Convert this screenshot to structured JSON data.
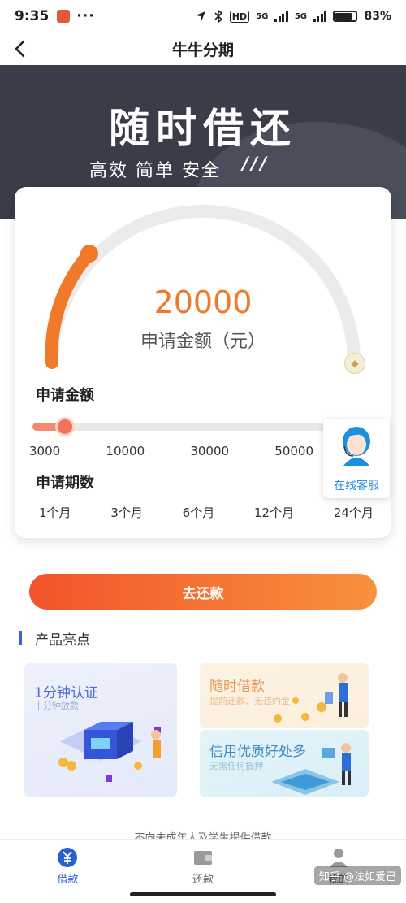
{
  "status_bar": {
    "time": "9:35",
    "dots": "···",
    "hd": "HD",
    "net1": "5G",
    "net2": "5G",
    "battery": "83%"
  },
  "nav": {
    "title": "牛牛分期"
  },
  "banner": {
    "title": "随时借还",
    "subtitle": "高效 简单 安全",
    "slashes": "///"
  },
  "loan": {
    "amount": "20000",
    "amount_label": "申请金额（元）",
    "amount_section_label": "申请金额",
    "slider_progress": 0.1,
    "amount_ticks": [
      "3000",
      "10000",
      "30000",
      "50000"
    ],
    "term_section_label": "申请期数",
    "terms": [
      "1个月",
      "3个月",
      "6个月",
      "12个月",
      "24个月"
    ]
  },
  "customer_service": {
    "label": "在线客服"
  },
  "repay_button": "去还款",
  "highlights": {
    "title": "产品亮点",
    "items": [
      {
        "title": "1分钟认证",
        "subtitle": "十分钟放款"
      },
      {
        "title": "随时借款",
        "subtitle": "提前还款、无违约金"
      },
      {
        "title": "信用优质好处多",
        "subtitle": "无需任何抵押"
      }
    ]
  },
  "footer_note": "不向未成年人及学生提供借款",
  "tabs": [
    {
      "label": "借款",
      "active": true
    },
    {
      "label": "还款",
      "active": false
    },
    {
      "label": "我的",
      "active": false
    }
  ],
  "watermark": "知乎 @法如爱己",
  "colors": {
    "accent": "#f07a2a",
    "brand_blue": "#2a5fd0",
    "banner_bg": "#3a3d48"
  }
}
